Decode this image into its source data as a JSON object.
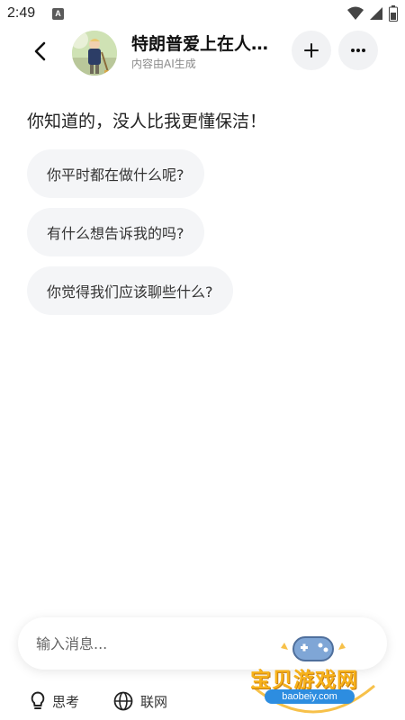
{
  "status": {
    "time": "2:49",
    "app_icon": "A"
  },
  "header": {
    "title": "特朗普爱上在人…",
    "subtitle": "内容由AI生成"
  },
  "chat": {
    "greeting": "你知道的，没人比我更懂保洁！",
    "suggestions": [
      "你平时都在做什么呢?",
      "有什么想告诉我的吗?",
      "你觉得我们应该聊些什么?"
    ]
  },
  "input": {
    "placeholder": "输入消息..."
  },
  "tools": {
    "think": "思考",
    "web": "联网"
  },
  "watermark": {
    "text": "宝贝游戏网",
    "url": "baobeiy.com"
  },
  "colors": {
    "bubble": "#f4f5f7",
    "accent": "#f7b21b"
  },
  "icons": [
    "back-icon",
    "plus-icon",
    "more-icon",
    "bulb-icon",
    "globe-icon",
    "wifi-icon",
    "signal-icon",
    "battery-icon"
  ]
}
